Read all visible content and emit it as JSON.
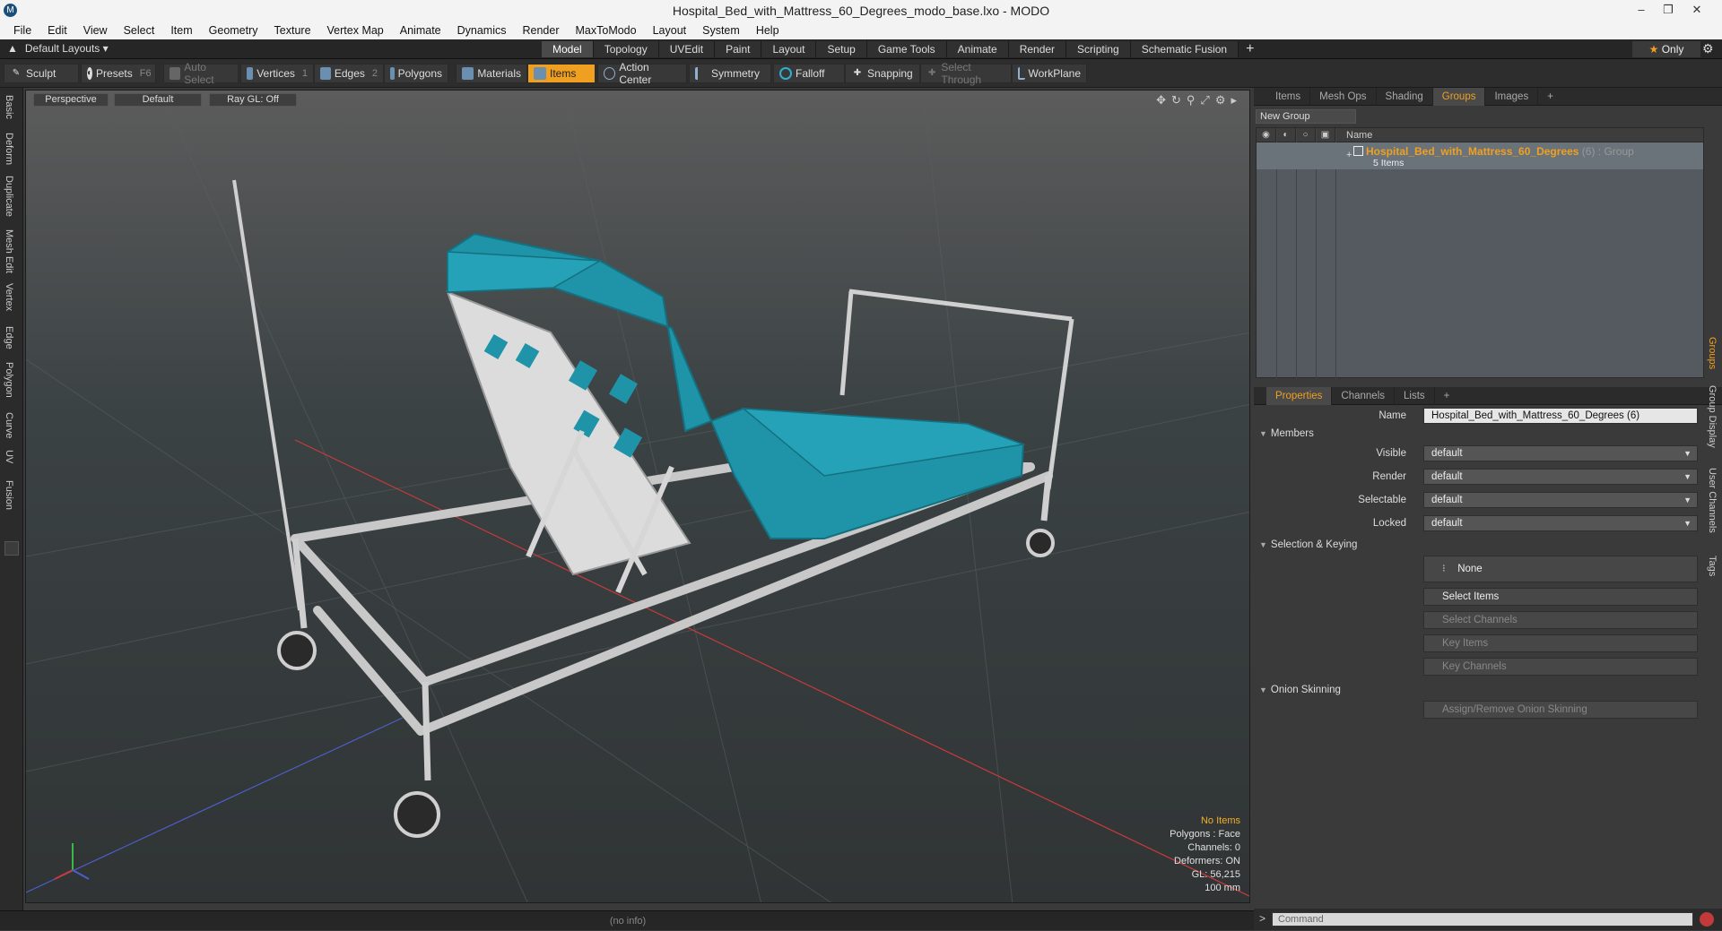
{
  "window": {
    "title": "Hospital_Bed_with_Mattress_60_Degrees_modo_base.lxo - MODO",
    "app_icon_letter": "M"
  },
  "menu": [
    "File",
    "Edit",
    "View",
    "Select",
    "Item",
    "Geometry",
    "Texture",
    "Vertex Map",
    "Animate",
    "Dynamics",
    "Render",
    "MaxToModo",
    "Layout",
    "System",
    "Help"
  ],
  "layouts": {
    "label": "Default Layouts ▾"
  },
  "tabs": [
    "Model",
    "Topology",
    "UVEdit",
    "Paint",
    "Layout",
    "Setup",
    "Game Tools",
    "Animate",
    "Render",
    "Scripting",
    "Schematic Fusion"
  ],
  "active_tab": "Model",
  "only_label": "Only",
  "toolbar": {
    "sculpt": "Sculpt",
    "presets": "Presets",
    "presets_key": "F6",
    "auto_select": "Auto Select",
    "vertices": "Vertices",
    "vertices_count": "1",
    "edges": "Edges",
    "edges_count": "2",
    "polygons": "Polygons",
    "materials": "Materials",
    "items": "Items",
    "action_center": "Action Center",
    "symmetry": "Symmetry",
    "falloff": "Falloff",
    "snapping": "Snapping",
    "select_through": "Select Through",
    "workplane": "WorkPlane"
  },
  "left_tabs": [
    "Basic",
    "Deform",
    "Duplicate",
    "Mesh Edit",
    "Vertex",
    "Edge",
    "Polygon",
    "Curve",
    "UV",
    "Fusion"
  ],
  "viewport": {
    "view": "Perspective",
    "shading": "Default",
    "raygl": "Ray GL: Off",
    "stats": {
      "items": "No Items",
      "polygons": "Polygons : Face",
      "channels": "Channels: 0",
      "deformers": "Deformers: ON",
      "gl": "GL: 56,215",
      "unit": "100 mm"
    }
  },
  "status": {
    "info": "(no info)"
  },
  "groups_panel": {
    "tabs": [
      "Items",
      "Mesh Ops",
      "Shading",
      "Groups",
      "Images"
    ],
    "active": "Groups",
    "new_group": "New Group",
    "name_header": "Name",
    "group_name": "Hospital_Bed_with_Mattress_60_Degrees",
    "group_count": "(6) : Group",
    "group_sub": "5 Items"
  },
  "properties_panel": {
    "tabs": [
      "Properties",
      "Channels",
      "Lists"
    ],
    "active": "Properties",
    "name_label": "Name",
    "name_value": "Hospital_Bed_with_Mattress_60_Degrees (6)",
    "members": "Members",
    "visible_label": "Visible",
    "visible_value": "default",
    "render_label": "Render",
    "render_value": "default",
    "selectable_label": "Selectable",
    "selectable_value": "default",
    "locked_label": "Locked",
    "locked_value": "default",
    "selection_keying": "Selection & Keying",
    "none": "None",
    "select_items": "Select Items",
    "select_channels": "Select Channels",
    "key_items": "Key Items",
    "key_channels": "Key Channels",
    "onion_skinning": "Onion Skinning",
    "assign_onion": "Assign/Remove Onion Skinning",
    "side_tabs": [
      "Groups",
      "Group Display",
      "User Channels",
      "Tags"
    ]
  },
  "command": {
    "placeholder": "Command"
  },
  "colors": {
    "accent": "#f0a020",
    "mattress": "#1f93a8",
    "frame": "#c8c8c8"
  }
}
